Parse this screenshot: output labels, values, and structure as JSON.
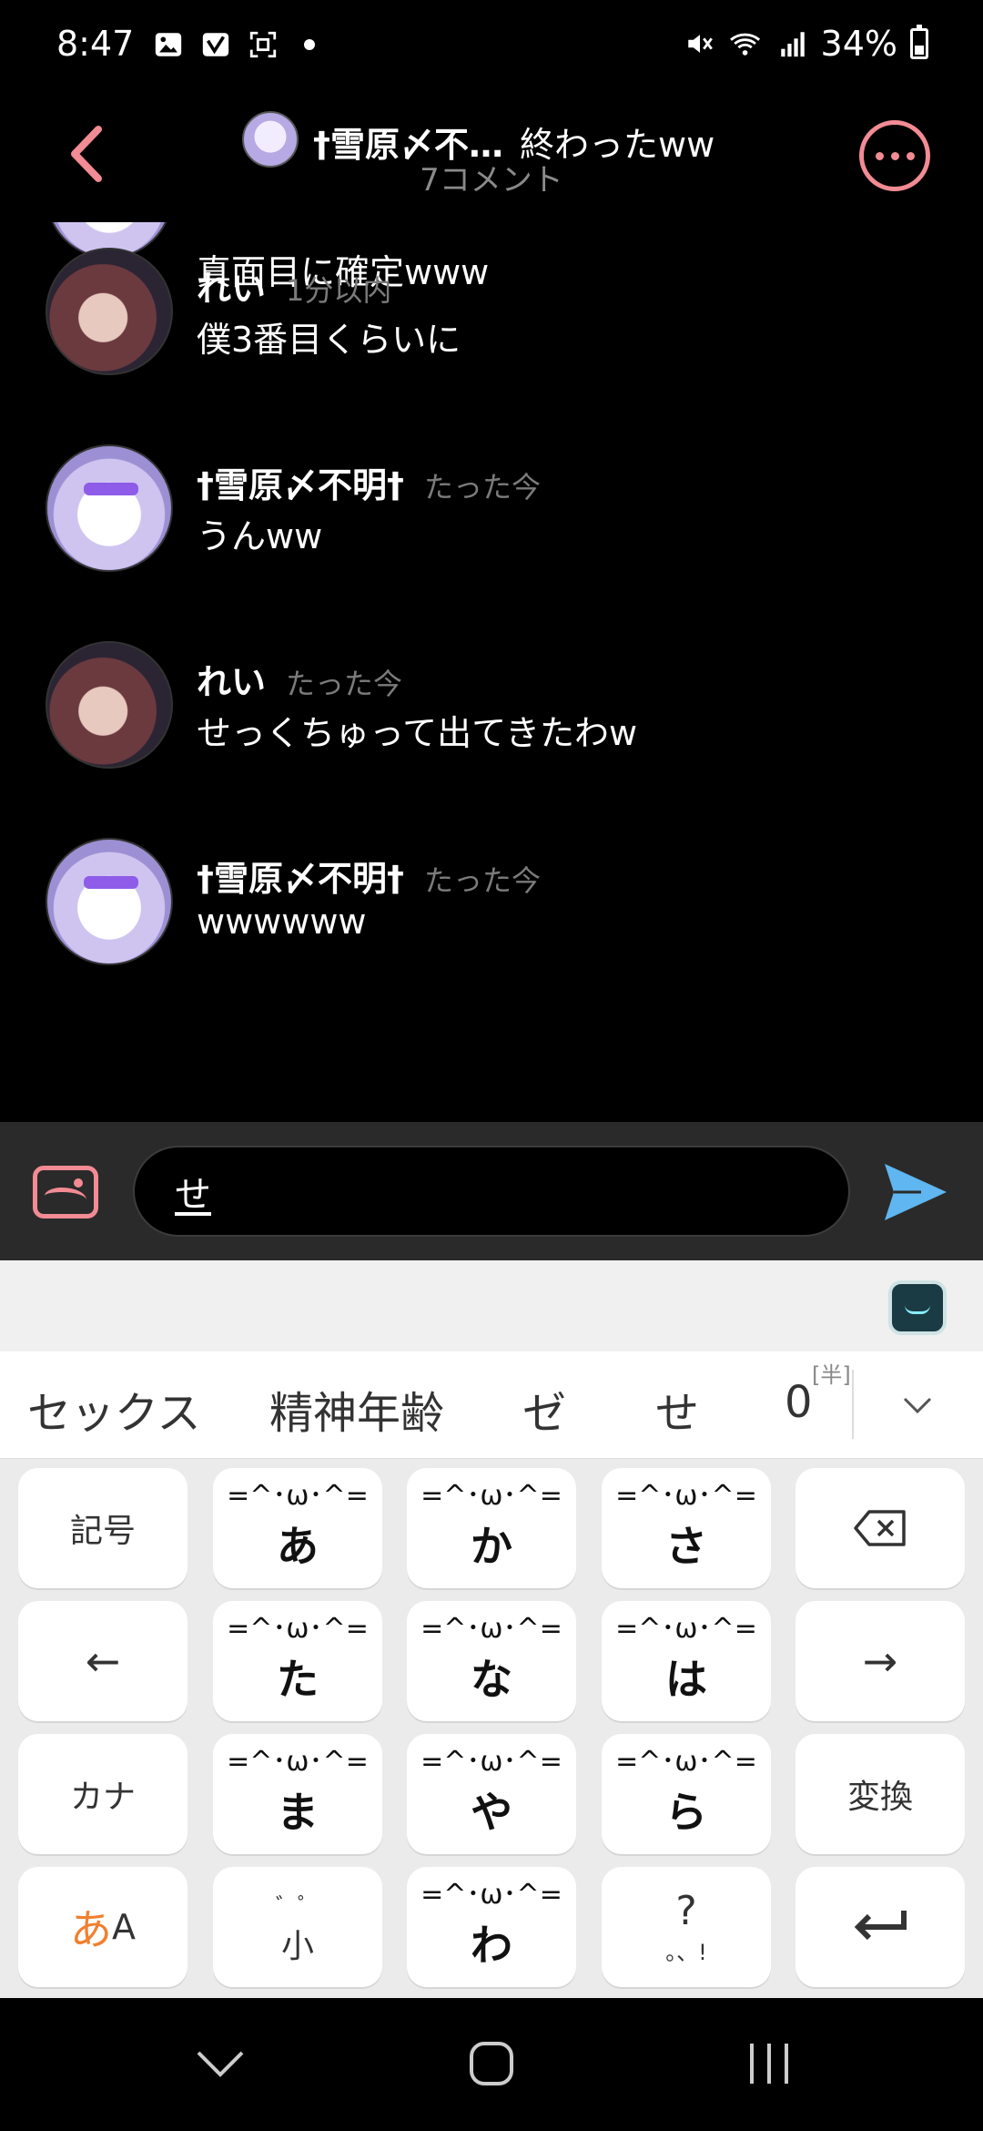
{
  "status_bar": {
    "time": "8:47",
    "battery": "34%"
  },
  "header": {
    "title_name": "†雪原〆不…",
    "title_message": "終わったww",
    "subtitle": "7コメント"
  },
  "comments": [
    {
      "author": "",
      "time": "",
      "text": "真面目に確定www",
      "avatar": "yuki"
    },
    {
      "author": "れい",
      "time": "1分以内",
      "text": "僕3番目くらいに",
      "avatar": "rei"
    },
    {
      "author": "†雪原〆不明†",
      "time": "たった今",
      "text": "うんww",
      "avatar": "yuki"
    },
    {
      "author": "れい",
      "time": "たった今",
      "text": "せっくちゅって出てきたわw",
      "avatar": "rei"
    },
    {
      "author": "†雪原〆不明†",
      "time": "たった今",
      "text": "wwwwww",
      "avatar": "yuki"
    }
  ],
  "input": {
    "value": "せ"
  },
  "keyboard": {
    "candidates": [
      "セックス",
      "精神年齢",
      "ゼ",
      "せ",
      "0"
    ],
    "candidate_tag": "[半]",
    "keys": {
      "symbols": "記号",
      "left": "←",
      "right": "→",
      "kana": "カナ",
      "convert": "変換",
      "a": "あ",
      "ka": "か",
      "sa": "さ",
      "ta": "た",
      "na": "な",
      "ha": "は",
      "ma": "ま",
      "ya": "や",
      "ra": "ら",
      "small_top": "゛゜",
      "small": "小",
      "wa": "わ",
      "punct_top": "?",
      "punct": "。、!",
      "mode_a": "あ",
      "mode_b": "A"
    }
  },
  "colors": {
    "accent_pink": "#f28b94",
    "send_blue": "#5fb6f0",
    "background": "#000000"
  }
}
